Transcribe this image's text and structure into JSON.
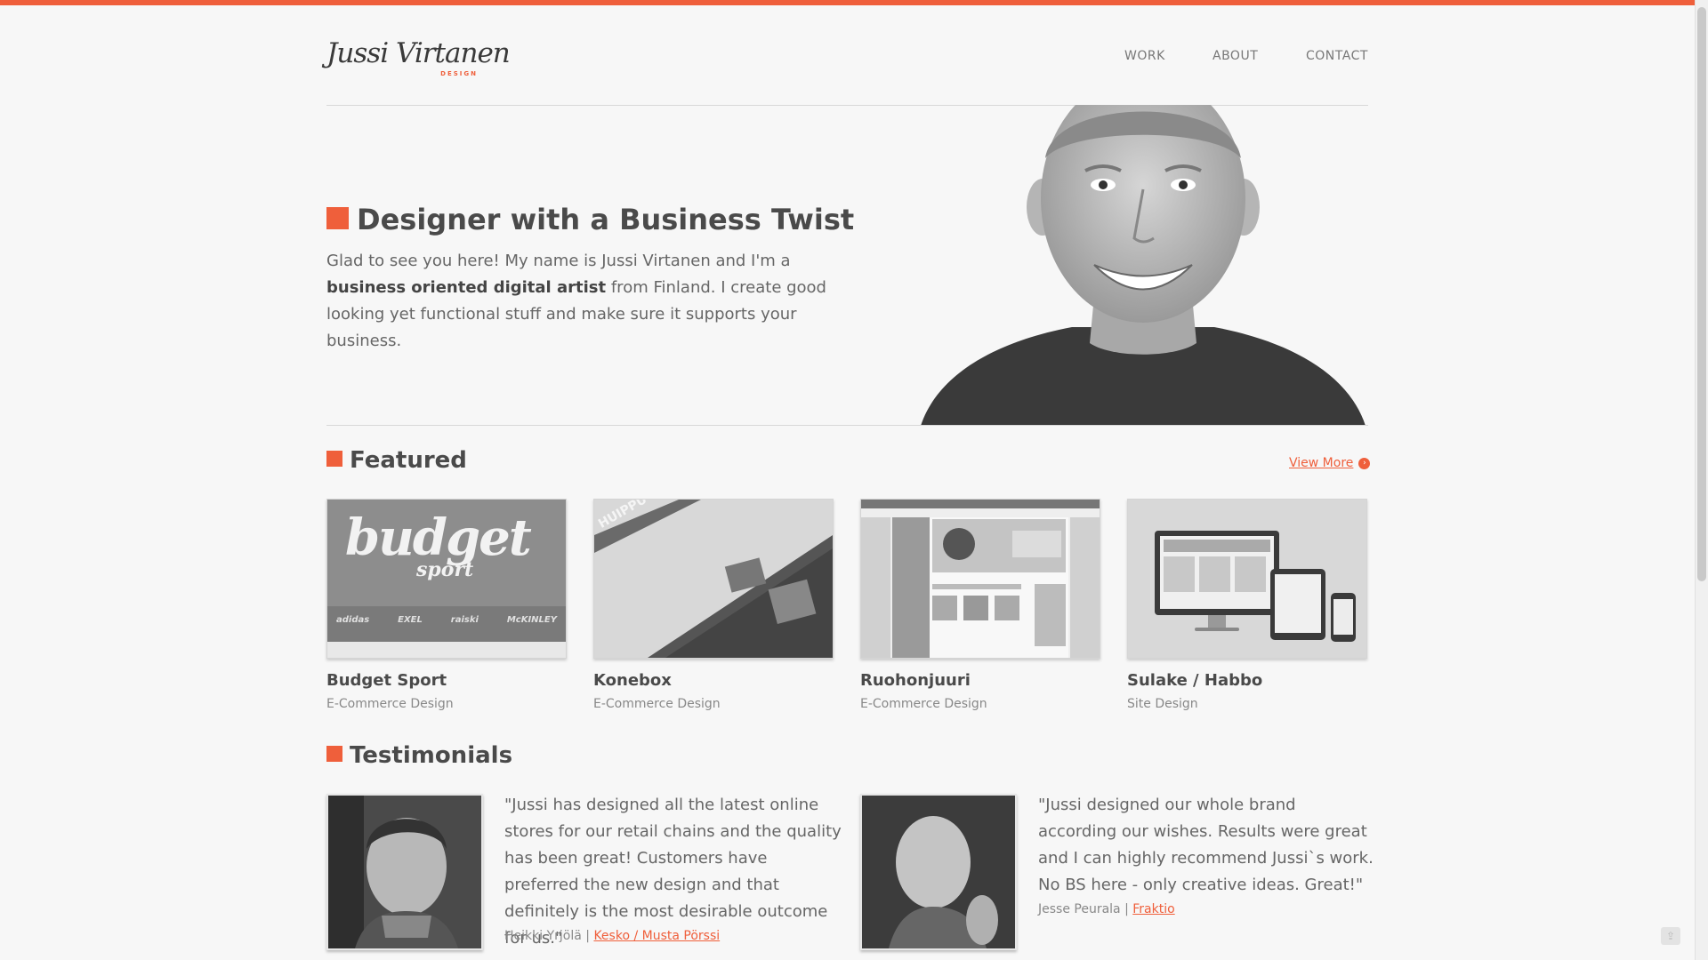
{
  "brand": {
    "name": "Jussi Virtanen",
    "tagline": "DESIGN",
    "accent_color": "#ef5f3b"
  },
  "nav": {
    "work": "WORK",
    "about": "ABOUT",
    "contact": "CONTACT"
  },
  "hero": {
    "title": "Designer with a Business Twist",
    "text_1": "Glad to see you here! My name is Jussi Virtanen and I'm a ",
    "text_bold": "business oriented digital artist",
    "text_2": " from Finland. I create good looking yet functional stuff and make sure it supports your business."
  },
  "featured": {
    "title": "Featured",
    "view_more": "View More",
    "items": [
      {
        "name": "Budget Sport",
        "category": "E-Commerce Design",
        "thumb_text": "budget",
        "thumb_subtext": "sport",
        "brands": [
          "adidas",
          "EXEL",
          "raiski",
          "McKINLEY"
        ]
      },
      {
        "name": "Konebox",
        "category": "E-Commerce Design",
        "thumb_text": "HUIPPU-UUTU"
      },
      {
        "name": "Ruohonjuuri",
        "category": "E-Commerce Design"
      },
      {
        "name": "Sulake / Habbo",
        "category": "Site Design"
      }
    ]
  },
  "testimonials": {
    "title": "Testimonials",
    "items": [
      {
        "quote": "\"Jussi has designed all the latest online stores for our retail chains and the quality has been great! Customers have preferred the new design and that definitely is the most desirable outcome for us.\"",
        "author": "Heikki Yrjölä",
        "separator": " | ",
        "company": "Kesko / Musta Pörssi"
      },
      {
        "quote": "\"Jussi designed our whole brand according our wishes. Results were great and I can highly recommend Jussi`s work. No BS here - only creative ideas. Great!\"",
        "author": "Jesse Peurala",
        "separator": " | ",
        "company": "Fraktio"
      }
    ]
  },
  "icons": {
    "view_more": "arrow-right-circle-icon",
    "share": "share-icon"
  }
}
